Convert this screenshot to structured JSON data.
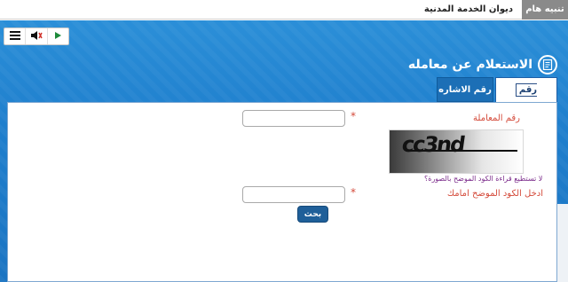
{
  "topbar": {
    "notice_label": "تنبيه هام",
    "ticker_text": "ديوان الخدمة المدنية"
  },
  "media": {
    "icons": [
      "menu-icon",
      "speaker-icon",
      "play-icon"
    ]
  },
  "page": {
    "title": "الاستعلام عن معامله",
    "title_icon": "document-icon"
  },
  "tabs": [
    {
      "label": "رقم المعاملة",
      "active": true
    },
    {
      "label": "رقم الاشاره",
      "active": false
    }
  ],
  "form": {
    "transaction_label": "رقم المعاملة",
    "transaction_value": "",
    "required_mark": "*",
    "captcha_text": "cc3nd",
    "captcha_help": "لا تستطيع قراءة الكود الموضح بالصورة؟",
    "code_label": "ادخل الكود الموضح امامك",
    "code_value": "",
    "search_label": "بحث"
  },
  "colors": {
    "brand_blue": "#1f7fcd",
    "required_red": "#d44a3a",
    "button_blue": "#1f5f99",
    "notice_gray": "#8a8a8a"
  }
}
